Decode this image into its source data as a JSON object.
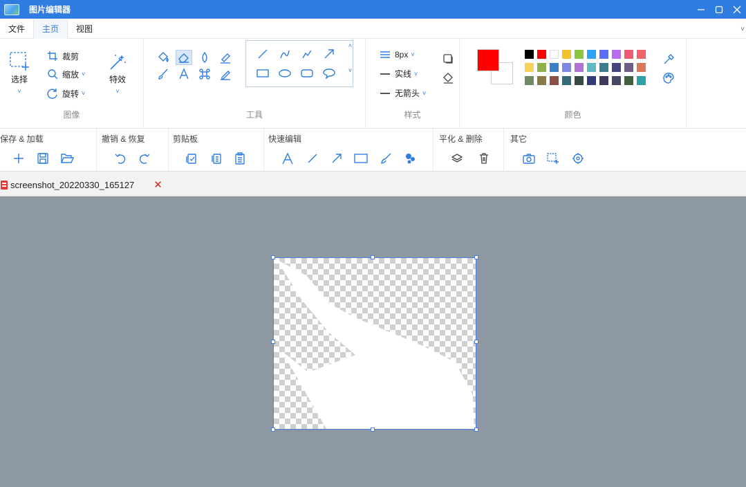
{
  "window": {
    "title": "图片编辑器"
  },
  "menu": {
    "tabs": [
      {
        "label": "文件"
      },
      {
        "label": "主页"
      },
      {
        "label": "视图"
      }
    ],
    "active": 1
  },
  "ribbon": {
    "image_group": {
      "label": "图像",
      "select": "选择",
      "crop": "裁剪",
      "zoom": "缩放",
      "rotate": "旋转",
      "effects": "特效"
    },
    "tools_group": {
      "label": "工具"
    },
    "style_group": {
      "label": "样式",
      "size": "8px",
      "line_style": "实线",
      "arrow": "无箭头"
    },
    "colors_group": {
      "label": "颜色",
      "primary": "#ff0000",
      "secondary": "#ffffff",
      "palette": [
        [
          "#000000",
          "#ff0000",
          "#ffffff",
          "#f2c12e",
          "#8cc63f",
          "#2ea3f2",
          "#5b6ef5",
          "#b86cf0",
          "#ef5a74",
          "#f1636b"
        ],
        [
          "#f5d35a",
          "#8fb24a",
          "#3b7fc4",
          "#7d87e6",
          "#b073d4",
          "#62b8c2",
          "#3c7d8c",
          "#45447e",
          "#6f5c87",
          "#d9785a"
        ],
        [
          "#6f8a65",
          "#8b7a46",
          "#8b5148",
          "#356a7a",
          "#364b43",
          "#333a78",
          "#403a5f",
          "#444865",
          "#3f5f3f",
          "#2fa0a8"
        ]
      ]
    }
  },
  "toolbar": {
    "groups": [
      {
        "title": "保存 & 加载"
      },
      {
        "title": "撤销 & 恢复"
      },
      {
        "title": "剪贴板"
      },
      {
        "title": "快速编辑"
      },
      {
        "title": "平化 & 删除"
      },
      {
        "title": "其它"
      }
    ]
  },
  "document": {
    "tab_name": "screenshot_20220330_165127",
    "close": "✕"
  }
}
